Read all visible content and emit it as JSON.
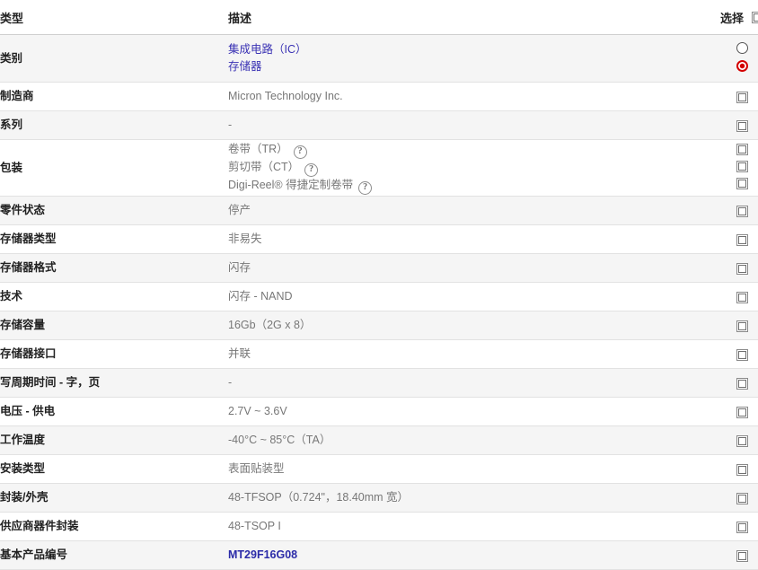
{
  "table": {
    "headers": {
      "type": "类型",
      "description": "描述",
      "select": "选择"
    },
    "rows": [
      {
        "label": "类别",
        "value_lines": [
          "集成电路（IC）",
          "存储器"
        ],
        "kind": "links",
        "control": "radio-pair"
      },
      {
        "label": "制造商",
        "value_lines": [
          "Micron Technology Inc."
        ],
        "kind": "text",
        "control": "checkbox"
      },
      {
        "label": "系列",
        "value_lines": [
          "-"
        ],
        "kind": "text",
        "control": "checkbox"
      },
      {
        "label": "包装",
        "value_lines": [
          "卷带（TR）",
          "剪切带（CT）",
          "Digi-Reel® 得捷定制卷带"
        ],
        "kind": "text-help",
        "control": "checkbox-triple"
      },
      {
        "label": "零件状态",
        "value_lines": [
          "停产"
        ],
        "kind": "text",
        "control": "checkbox"
      },
      {
        "label": "存储器类型",
        "value_lines": [
          "非易失"
        ],
        "kind": "text",
        "control": "checkbox"
      },
      {
        "label": "存储器格式",
        "value_lines": [
          "闪存"
        ],
        "kind": "text",
        "control": "checkbox"
      },
      {
        "label": "技术",
        "value_lines": [
          "闪存 - NAND"
        ],
        "kind": "text",
        "control": "checkbox"
      },
      {
        "label": "存储容量",
        "value_lines": [
          "16Gb（2G x 8）"
        ],
        "kind": "text",
        "control": "checkbox"
      },
      {
        "label": "存储器接口",
        "value_lines": [
          "并联"
        ],
        "kind": "text",
        "control": "checkbox"
      },
      {
        "label": "写周期时间 - 字，页",
        "value_lines": [
          "-"
        ],
        "kind": "text",
        "control": "checkbox"
      },
      {
        "label": "电压 - 供电",
        "value_lines": [
          "2.7V ~ 3.6V"
        ],
        "kind": "text",
        "control": "checkbox"
      },
      {
        "label": "工作温度",
        "value_lines": [
          "-40°C ~ 85°C（TA）"
        ],
        "kind": "text",
        "control": "checkbox"
      },
      {
        "label": "安装类型",
        "value_lines": [
          "表面贴装型"
        ],
        "kind": "text",
        "control": "checkbox"
      },
      {
        "label": "封装/外壳",
        "value_lines": [
          "48-TFSOP（0.724\"，18.40mm 宽）"
        ],
        "kind": "text",
        "control": "checkbox"
      },
      {
        "label": "供应商器件封装",
        "value_lines": [
          "48-TSOP I"
        ],
        "kind": "text",
        "control": "checkbox"
      },
      {
        "label": "基本产品编号",
        "value_lines": [
          "MT29F16G08"
        ],
        "kind": "link-bold",
        "control": "checkbox"
      }
    ]
  },
  "icons": {
    "help": "?",
    "help_name": "help-icon"
  },
  "colors": {
    "link": "#3a32b4",
    "link_bold": "#2b2ba8",
    "radio_selected": "#d40000",
    "row_shade": "#f5f5f5",
    "text_label": "#222222",
    "text_value": "#777777"
  }
}
